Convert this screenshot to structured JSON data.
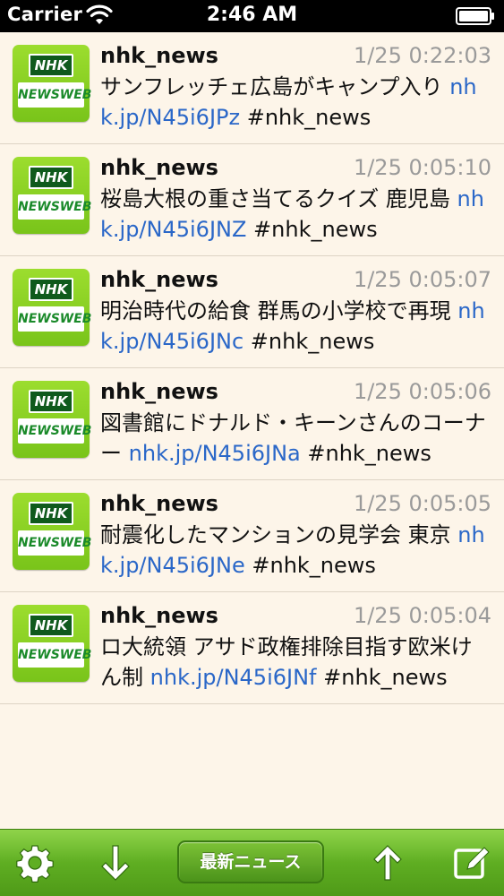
{
  "status_bar": {
    "carrier": "Carrier",
    "time": "2:46 AM"
  },
  "avatar": {
    "top_text": "NHK",
    "bottom_text": "NEWSWEB"
  },
  "tweets": [
    {
      "user": "nhk_news",
      "time": "1/25 0:22:03",
      "text": "サンフレッチェ広島がキャンプ入り ",
      "link": "nhk.jp/N45i6JPz",
      "tag": " #nhk_news"
    },
    {
      "user": "nhk_news",
      "time": "1/25 0:05:10",
      "text": "桜島大根の重さ当てるクイズ 鹿児島 ",
      "link": "nhk.jp/N45i6JNZ",
      "tag": " #nhk_news"
    },
    {
      "user": "nhk_news",
      "time": "1/25 0:05:07",
      "text": "明治時代の給食 群馬の小学校で再現 ",
      "link": "nhk.jp/N45i6JNc",
      "tag": " #nhk_news"
    },
    {
      "user": "nhk_news",
      "time": "1/25 0:05:06",
      "text": "図書館にドナルド・キーンさんのコーナー ",
      "link": "nhk.jp/N45i6JNa",
      "tag": " #nhk_news"
    },
    {
      "user": "nhk_news",
      "time": "1/25 0:05:05",
      "text": "耐震化したマンションの見学会 東京 ",
      "link": "nhk.jp/N45i6JNe",
      "tag": " #nhk_news"
    },
    {
      "user": "nhk_news",
      "time": "1/25 0:05:04",
      "text": "ロ大統領 アサド政権排除目指す欧米けん制 ",
      "link": "nhk.jp/N45i6JNf",
      "tag": " #nhk_news"
    }
  ],
  "toolbar": {
    "refresh_label": "最新ニュース",
    "icons": [
      "gear-icon",
      "arrow-down-icon",
      "arrow-up-icon",
      "compose-icon"
    ]
  },
  "colors": {
    "background": "#fdf5e9",
    "link": "#2a67c8",
    "toolbar": "#5fae22"
  }
}
